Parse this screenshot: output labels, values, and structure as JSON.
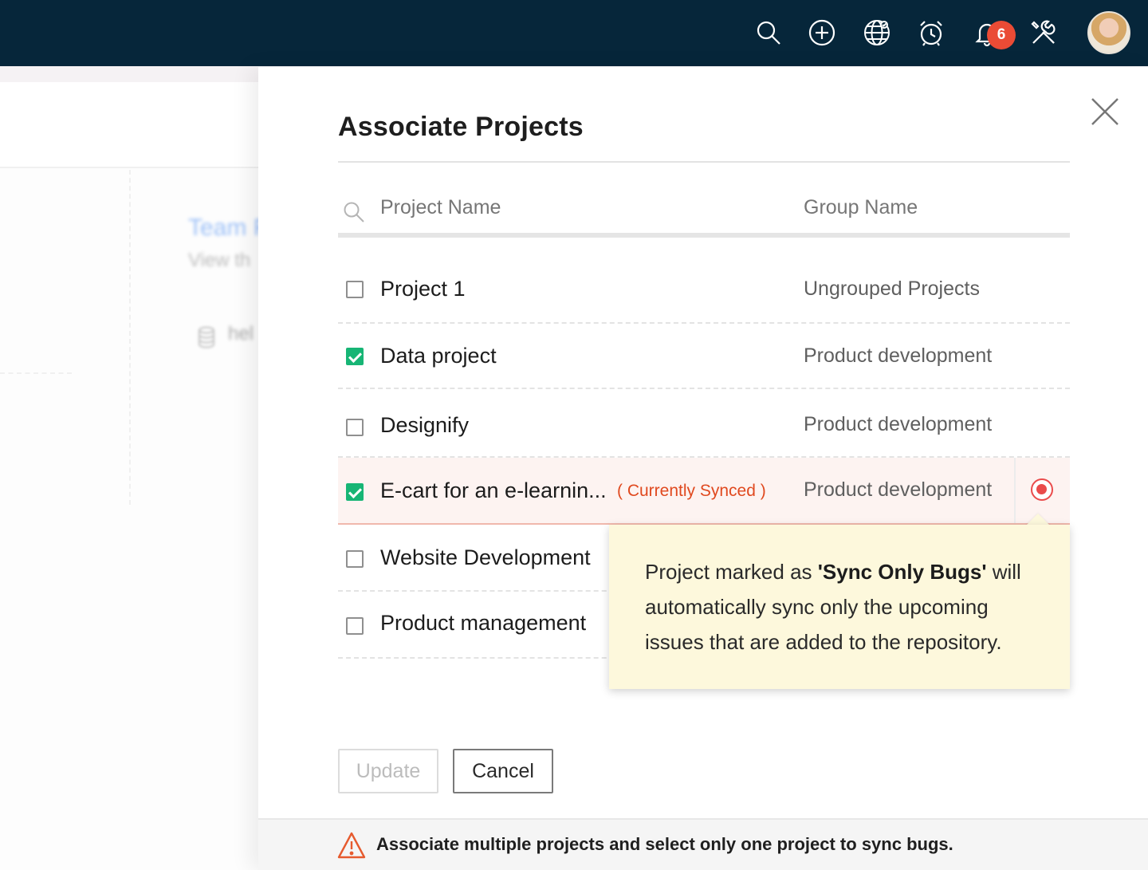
{
  "topbar": {
    "icons": [
      "search-icon",
      "add-icon",
      "globe-icon",
      "alarm-clock-icon",
      "bell-icon",
      "tools-icon"
    ],
    "notification_count": "6"
  },
  "background_page": {
    "title": "Team F",
    "subtitle": "View th",
    "item": "hel"
  },
  "drawer": {
    "title": "Associate Projects",
    "columns": {
      "project_name": "Project Name",
      "group_name": "Group Name"
    },
    "rows": [
      {
        "project": "Project 1",
        "group": "Ungrouped Projects",
        "checked": false
      },
      {
        "project": "Data project",
        "group": "Product development",
        "checked": true
      },
      {
        "project": "Designify",
        "group": "Product development",
        "checked": false
      },
      {
        "project": "E-cart for an e-learnin...",
        "group": "Product development",
        "checked": true,
        "synced_label": "( Currently Synced )"
      },
      {
        "project": "Website Development",
        "group": "",
        "checked": false
      },
      {
        "project": "Product management",
        "group": "",
        "checked": false
      }
    ],
    "tooltip": {
      "prefix": "Project marked as ",
      "highlight": "'Sync Only Bugs'",
      "suffix": " will automatically sync only the upcoming issues that are added to the repository."
    },
    "buttons": {
      "update": "Update",
      "cancel": "Cancel"
    },
    "footer_warning": "Associate multiple projects and select only one project to sync bugs.",
    "colors": {
      "topbar": "#06263a",
      "check": "#17b575",
      "synced": "#e0491f",
      "badge": "#ea4b35",
      "tooltip_bg": "#fdf8dc"
    }
  }
}
